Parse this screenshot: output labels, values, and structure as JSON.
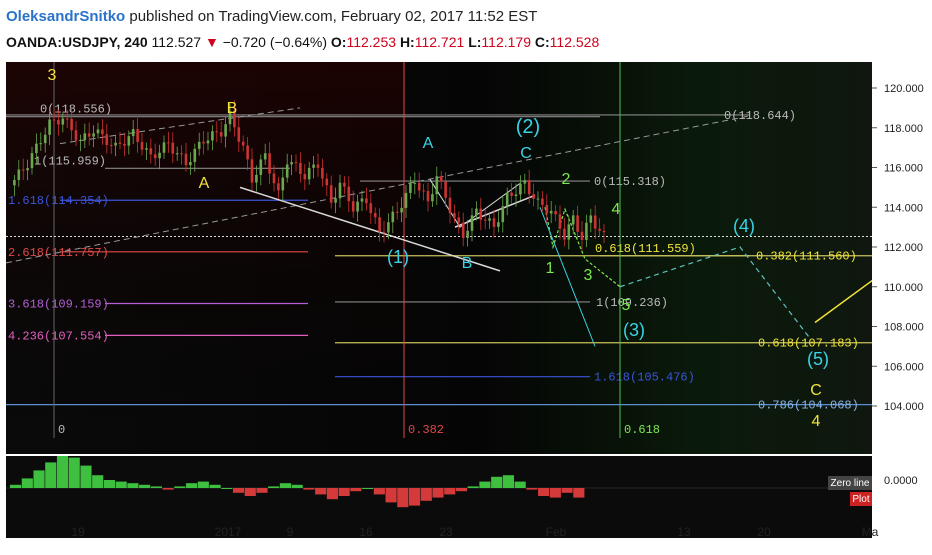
{
  "header": {
    "author": "OleksandrSnitko",
    "published_text": "published on TradingView.com, February 02, 2017 11:52 EST",
    "symbol": "OANDA:USDJPY, 240",
    "last_price": "112.527",
    "change": "−0.720 (−0.64%)",
    "change_direction_icon": "down-triangle-icon",
    "ohlc": {
      "o_label": "O:",
      "o": "112.253",
      "h_label": "H:",
      "h": "112.721",
      "l_label": "L:",
      "l": "112.179",
      "c_label": "C:",
      "c": "112.528"
    }
  },
  "colors": {
    "background": "#000000",
    "candle_up": "#6aa84f",
    "candle_down": "#cc3333",
    "wave_yellow": "#f2e33b",
    "wave_cyan": "#39d3e6",
    "wave_green": "#7ee84f",
    "fib_blue": "#3b55d9",
    "fib_red": "#e04848",
    "fib_purple": "#b45fd6",
    "fib_magenta": "#e05fc0",
    "osc_up": "#3fbf3f",
    "osc_down": "#d43a3a"
  },
  "chart_data": {
    "type": "candlestick",
    "instrument": "OANDA:USDJPY",
    "timeframe": "240",
    "ylim": [
      102.3,
      121.4
    ],
    "price_axis": [
      "120.000",
      "118.000",
      "116.000",
      "114.000",
      "112.000",
      "110.000",
      "108.000",
      "106.000",
      "104.000"
    ],
    "time_axis": [
      "19",
      "2017",
      "9",
      "16",
      "23",
      "Feb",
      "13",
      "20",
      "Ma"
    ],
    "last_price_line": 112.527,
    "price_path": [
      [
        0,
        115.1
      ],
      [
        4,
        116.2
      ],
      [
        9,
        118.2
      ],
      [
        12,
        118.5
      ],
      [
        16,
        117.3
      ],
      [
        19,
        117.9
      ],
      [
        24,
        117.0
      ],
      [
        28,
        117.7
      ],
      [
        32,
        116.5
      ],
      [
        36,
        117.2
      ],
      [
        40,
        116.2
      ],
      [
        44,
        117.4
      ],
      [
        48,
        117.8
      ],
      [
        50,
        118.6
      ],
      [
        53,
        117.0
      ],
      [
        55,
        115.4
      ],
      [
        58,
        116.6
      ],
      [
        61,
        114.6
      ],
      [
        63,
        116.4
      ],
      [
        67,
        115.6
      ],
      [
        70,
        116.2
      ],
      [
        73,
        114.2
      ],
      [
        75,
        115.2
      ],
      [
        78,
        114.0
      ],
      [
        81,
        114.4
      ],
      [
        84,
        112.7
      ],
      [
        88,
        113.8
      ],
      [
        92,
        115.4
      ],
      [
        95,
        114.2
      ],
      [
        97,
        115.6
      ],
      [
        99,
        114.5
      ],
      [
        101,
        113.4
      ],
      [
        103,
        112.6
      ],
      [
        106,
        113.8
      ],
      [
        110,
        113.0
      ],
      [
        113,
        114.5
      ],
      [
        117,
        115.2
      ],
      [
        120,
        114.2
      ],
      [
        123,
        113.8
      ],
      [
        126,
        112.6
      ],
      [
        128,
        113.4
      ],
      [
        130,
        112.5
      ],
      [
        132,
        113.5
      ],
      [
        135,
        112.5
      ]
    ],
    "fib_levels": [
      {
        "text": "0(118.556)",
        "color": "#bbbbbb"
      },
      {
        "text": "1(115.959)",
        "color": "#bbbbbb"
      },
      {
        "text": "1.618(114.354)",
        "color": "#3b55d9"
      },
      {
        "text": "2.618(111.757)",
        "color": "#e04848"
      },
      {
        "text": "3.618(109.159)",
        "color": "#b45fd6"
      },
      {
        "text": "4.236(107.554)",
        "color": "#e05fc0"
      },
      {
        "text": "0(118.644)",
        "color": "#bbbbbb"
      },
      {
        "text": "0(115.318)",
        "color": "#bbbbbb"
      },
      {
        "text": "0.618(111.559)",
        "color": "#f2e33b"
      },
      {
        "text": "1(109.236)",
        "color": "#bbbbbb"
      },
      {
        "text": "1.618(105.476)",
        "color": "#3b55d9"
      },
      {
        "text": "0.382(111.560)",
        "color": "#f2e33b"
      },
      {
        "text": "0.618(107.183)",
        "color": "#f2e33b"
      },
      {
        "text": "0.786(104.068)",
        "color": "#8ab4e8"
      }
    ],
    "time_fib_labels": [
      "0",
      "0.382",
      "0.618"
    ],
    "wave_labels": [
      {
        "text": "3",
        "color": "#f2e33b"
      },
      {
        "text": "B",
        "color": "#f2e33b"
      },
      {
        "text": "A",
        "color": "#f2e33b"
      },
      {
        "text": "A",
        "color": "#39d3e6"
      },
      {
        "text": "(2)",
        "color": "#39d3e6"
      },
      {
        "text": "C",
        "color": "#39d3e6"
      },
      {
        "text": "2",
        "color": "#7ee84f"
      },
      {
        "text": "4",
        "color": "#7ee84f"
      },
      {
        "text": "(1)",
        "color": "#39d3e6"
      },
      {
        "text": "B",
        "color": "#39d3e6"
      },
      {
        "text": "1",
        "color": "#7ee84f"
      },
      {
        "text": "3",
        "color": "#7ee84f"
      },
      {
        "text": "5",
        "color": "#7ee84f"
      },
      {
        "text": "(3)",
        "color": "#39d3e6"
      },
      {
        "text": "(4)",
        "color": "#39d3e6"
      },
      {
        "text": "(5)",
        "color": "#39d3e6"
      },
      {
        "text": "C",
        "color": "#f2e33b"
      },
      {
        "text": "4",
        "color": "#f2e33b"
      }
    ],
    "oscillator": {
      "axis_label": "0.0000",
      "zero_line_label": "Zero line",
      "plot_label": "Plot",
      "values": [
        0.1,
        0.3,
        0.55,
        0.8,
        1.0,
        0.95,
        0.7,
        0.4,
        0.25,
        0.2,
        0.15,
        0.1,
        0.05,
        -0.05,
        0.05,
        0.15,
        0.2,
        0.1,
        0.0,
        -0.15,
        -0.25,
        -0.15,
        0.05,
        0.15,
        0.1,
        -0.05,
        -0.2,
        -0.35,
        -0.25,
        -0.1,
        0.0,
        -0.2,
        -0.45,
        -0.6,
        -0.55,
        -0.4,
        -0.3,
        -0.2,
        -0.1,
        0.05,
        0.2,
        0.35,
        0.4,
        0.2,
        -0.05,
        -0.25,
        -0.3,
        -0.15,
        -0.3
      ]
    }
  }
}
